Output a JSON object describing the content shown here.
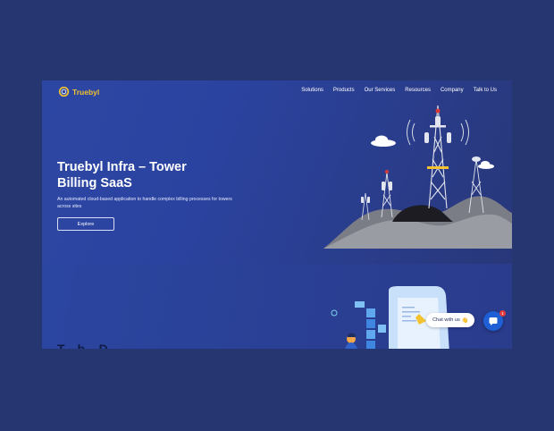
{
  "brand": {
    "name": "Truebyl",
    "color": "#f2c230",
    "icon": "ring-logo-icon"
  },
  "nav": {
    "items": [
      "Solutions",
      "Products",
      "Our Services",
      "Resources",
      "Company",
      "Talk to Us"
    ]
  },
  "hero": {
    "title": "Truebyl Infra – Tower Billing SaaS",
    "subtitle": "An automated cloud-based application to handle complex billing processes for towers across sites",
    "cta_label": "Explore"
  },
  "section2": {
    "heading_partial": "T... b...  D..."
  },
  "chat": {
    "label": "Chat with us",
    "emoji": "👋",
    "badge_count": "1",
    "icon": "chat-bubble-icon"
  },
  "colors": {
    "page_bg": "#253671",
    "hero_bg": "#2c47a3",
    "accent": "#f2c230",
    "chat_button": "#1f5fd6",
    "badge": "#e23b3b"
  }
}
